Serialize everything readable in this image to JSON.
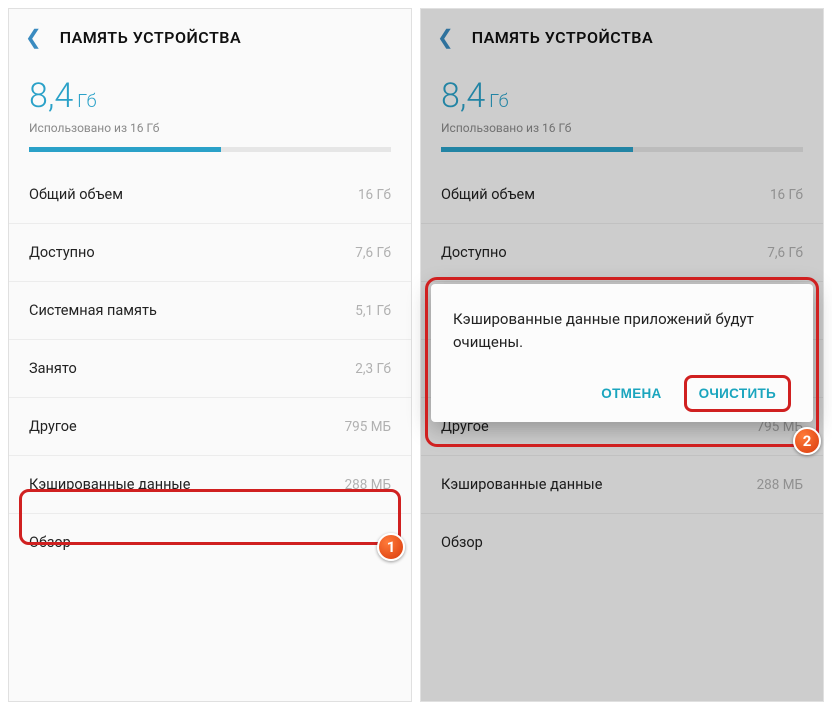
{
  "title": "ПАМЯТЬ УСТРОЙСТВА",
  "used": {
    "value": "8,4",
    "unit": "Гб",
    "note": "Использовано из 16 Гб",
    "percent": 53
  },
  "rows": [
    {
      "label": "Общий объем",
      "value": "16 Гб"
    },
    {
      "label": "Доступно",
      "value": "7,6 Гб"
    },
    {
      "label": "Системная память",
      "value": "5,1 Гб"
    },
    {
      "label": "Занято",
      "value": "2,3 Гб"
    },
    {
      "label": "Другое",
      "value": "795 МБ"
    },
    {
      "label": "Кэшированные данные",
      "value": "288 МБ"
    },
    {
      "label": "Обзор",
      "value": ""
    }
  ],
  "dialog": {
    "text": "Кэшированные данные приложений будут очищены.",
    "cancel": "ОТМЕНА",
    "confirm": "ОЧИСТИТЬ"
  },
  "badges": {
    "one": "1",
    "two": "2"
  }
}
